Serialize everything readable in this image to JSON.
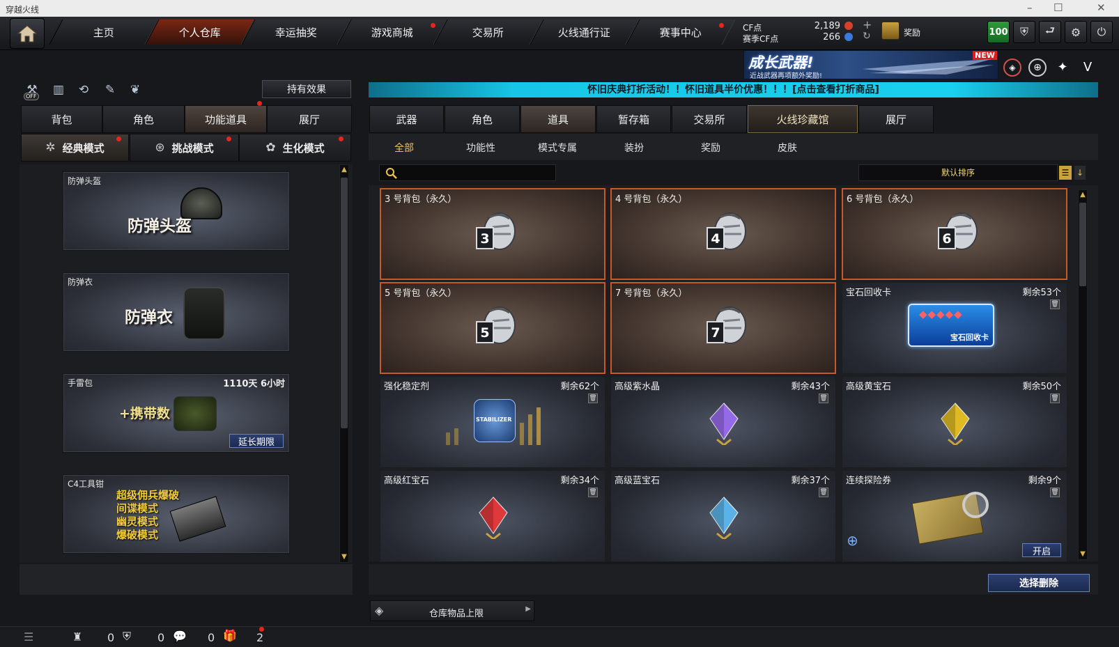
{
  "window": {
    "title": "穿越火线"
  },
  "nav": {
    "tabs": [
      {
        "label": "主页"
      },
      {
        "label": "个人仓库",
        "active": true
      },
      {
        "label": "幸运抽奖"
      },
      {
        "label": "游戏商城",
        "badge": true
      },
      {
        "label": "交易所"
      },
      {
        "label": "火线通行证"
      },
      {
        "label": "赛事中心",
        "badge": true
      }
    ]
  },
  "currency": {
    "cf_label": "CF点",
    "cf_value": "2,189",
    "season_label": "赛季CF点",
    "season_value": "266",
    "reward_label": "奖励"
  },
  "topright": {
    "level_badge": "100"
  },
  "banner": {
    "text": "成长武器!",
    "subtext": "近战武器再项额外奖励!",
    "new_tag": "NEW"
  },
  "left": {
    "effect_button": "持有效果",
    "toggle_off": "OFF",
    "tabs": [
      {
        "label": "背包"
      },
      {
        "label": "角色"
      },
      {
        "label": "功能道具",
        "active": true,
        "badge": true
      },
      {
        "label": "展厅"
      }
    ],
    "modes": [
      {
        "label": "经典模式",
        "active": true,
        "badge": true
      },
      {
        "label": "挑战模式",
        "badge": true
      },
      {
        "label": "生化模式",
        "badge": true
      }
    ],
    "cards": [
      {
        "label": "防弹头盔",
        "big": "防弹头盔"
      },
      {
        "label": "防弹衣",
        "big": "防弹衣"
      },
      {
        "label": "手雷包",
        "big": "+携带数",
        "time": "1110天 6小时",
        "button": "延长期限"
      },
      {
        "label": "C4工具钳",
        "lines": [
          "超级佣兵爆破",
          "间谍模式",
          "幽灵模式",
          "爆破模式"
        ]
      }
    ]
  },
  "promo": {
    "text": "怀旧庆典打折活动！！怀旧道具半价优惠！！！[点击查看打折商品]"
  },
  "right": {
    "tabs": [
      {
        "label": "武器"
      },
      {
        "label": "角色"
      },
      {
        "label": "道具",
        "active": true
      },
      {
        "label": "暂存箱"
      },
      {
        "label": "交易所"
      },
      {
        "label": "火线珍藏馆",
        "special": true
      },
      {
        "label": "展厅"
      }
    ],
    "subtabs": [
      {
        "label": "全部",
        "active": true
      },
      {
        "label": "功能性"
      },
      {
        "label": "模式专属"
      },
      {
        "label": "装扮"
      },
      {
        "label": "奖励"
      },
      {
        "label": "皮肤"
      }
    ],
    "search": {
      "placeholder": ""
    },
    "sort": {
      "label": "默认排序"
    },
    "items": [
      {
        "name": "3 号背包（永久）",
        "num": "3",
        "type": "bag"
      },
      {
        "name": "4 号背包（永久）",
        "num": "4",
        "type": "bag"
      },
      {
        "name": "6 号背包（永久）",
        "num": "6",
        "type": "bag"
      },
      {
        "name": "5 号背包（永久）",
        "num": "5",
        "type": "bag"
      },
      {
        "name": "7 号背包（永久）",
        "num": "7",
        "type": "bag"
      },
      {
        "name": "宝石回收卡",
        "remaining": "剩余53个",
        "type": "card",
        "card_text": "宝石回收卡"
      },
      {
        "name": "强化稳定剂",
        "remaining": "剩余62个",
        "type": "jar",
        "jar_text": "STABILIZER"
      },
      {
        "name": "高级紫水晶",
        "remaining": "剩余43个",
        "type": "gem",
        "color": "#9a6cf0"
      },
      {
        "name": "高级黄宝石",
        "remaining": "剩余50个",
        "type": "gem",
        "color": "#e8c020"
      },
      {
        "name": "高级红宝石",
        "remaining": "剩余34个",
        "type": "gem",
        "color": "#e8383a"
      },
      {
        "name": "高级蓝宝石",
        "remaining": "剩余37个",
        "type": "gem",
        "color": "#5cb8f0"
      },
      {
        "name": "连续探险券",
        "remaining": "剩余9个",
        "type": "map",
        "button": "开启"
      }
    ],
    "delete_button": "选择删除",
    "warehouse_limit": "仓库物品上限"
  },
  "status": {
    "count1": "0",
    "count2": "0",
    "count3": "0",
    "count4": "2"
  }
}
